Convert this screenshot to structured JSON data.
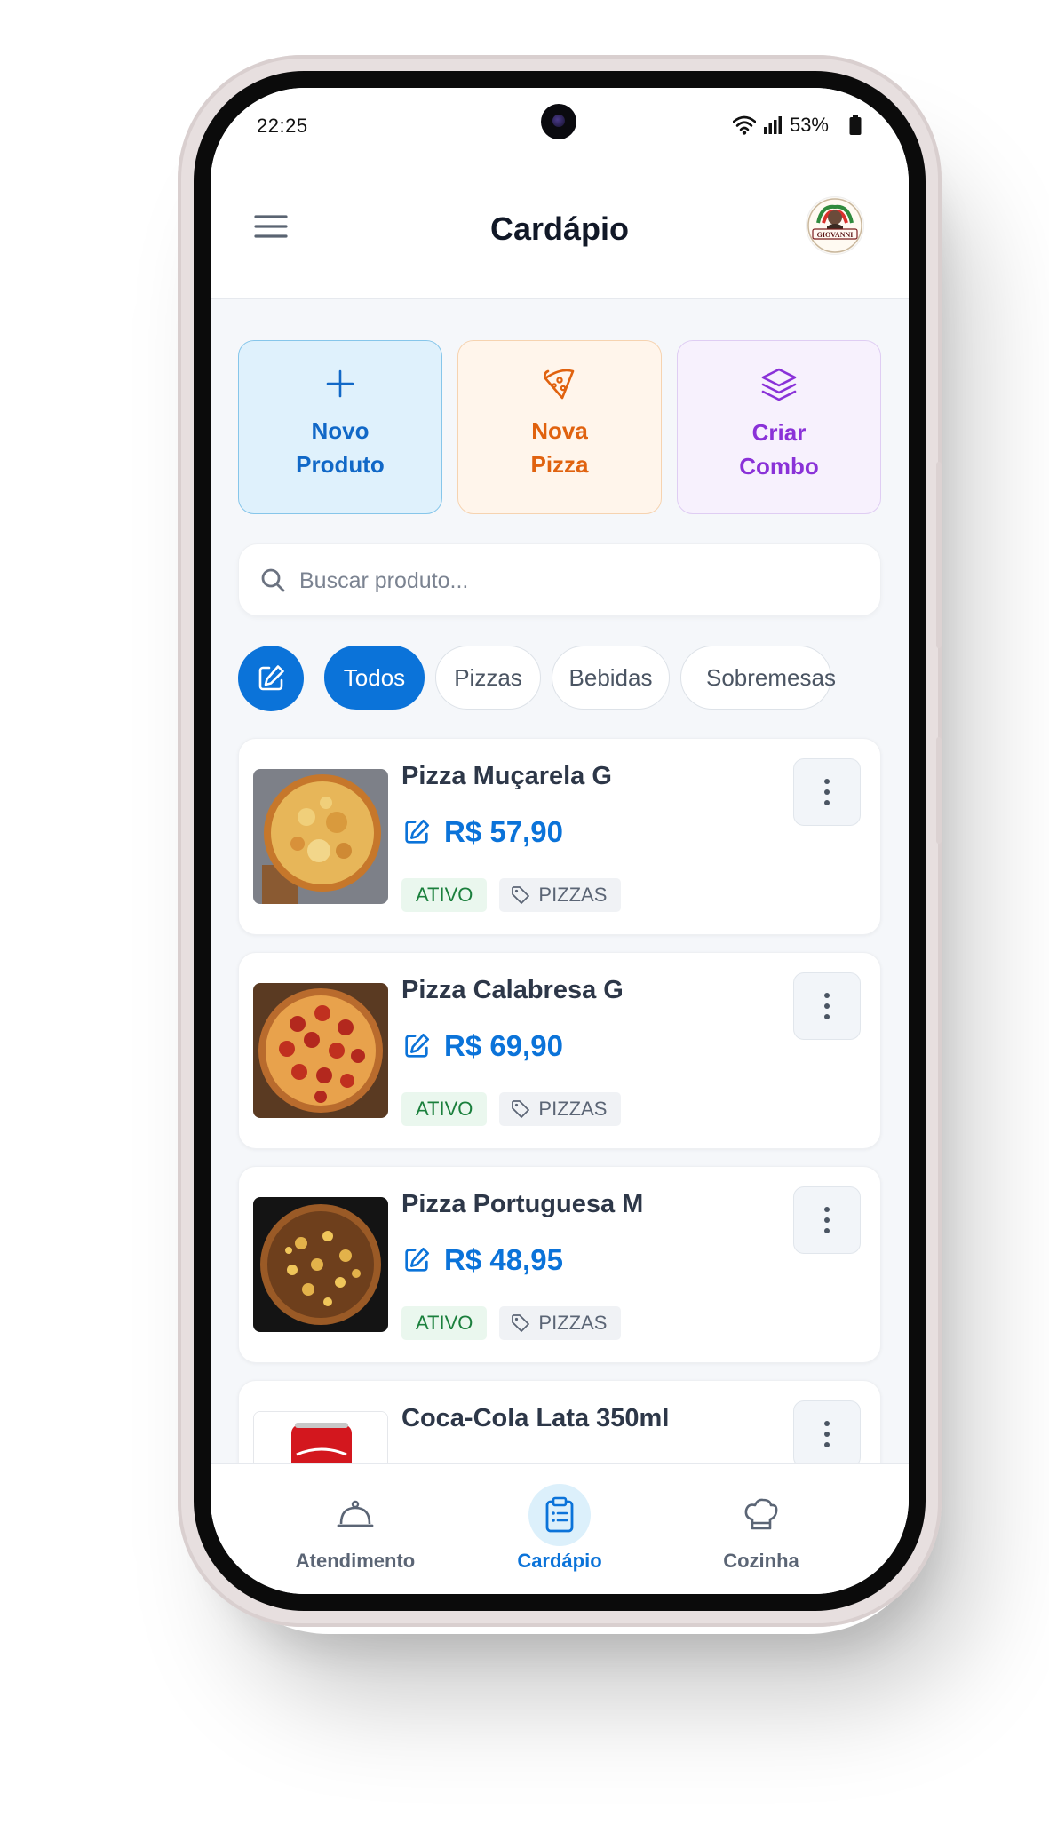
{
  "status_bar": {
    "time": "22:25",
    "battery": "53%"
  },
  "header": {
    "title": "Cardápio",
    "logo_text": "GIOVANNI"
  },
  "actions": [
    {
      "label": "Novo\nProduto",
      "icon": "plus-icon"
    },
    {
      "label": "Nova\nPizza",
      "icon": "pizza-slice-icon"
    },
    {
      "label": "Criar\nCombo",
      "icon": "layers-icon"
    }
  ],
  "search": {
    "placeholder": "Buscar produto..."
  },
  "filters": {
    "edit_icon": "edit-icon",
    "chips": [
      "Todos",
      "Pizzas",
      "Bebidas",
      "Sobremesas"
    ],
    "selected": "Todos"
  },
  "products": [
    {
      "name": "Pizza Muçarela G",
      "price": "R$ 57,90",
      "status": "ATIVO",
      "category": "PIZZAS"
    },
    {
      "name": "Pizza Calabresa G",
      "price": "R$ 69,90",
      "status": "ATIVO",
      "category": "PIZZAS"
    },
    {
      "name": "Pizza Portuguesa M",
      "price": "R$ 48,95",
      "status": "ATIVO",
      "category": "PIZZAS"
    },
    {
      "name": "Coca-Cola Lata 350ml"
    }
  ],
  "bottom_nav": [
    {
      "label": "Atendimento",
      "icon": "service-bell-icon"
    },
    {
      "label": "Cardápio",
      "icon": "clipboard-list-icon",
      "active": true
    },
    {
      "label": "Cozinha",
      "icon": "chef-hat-icon"
    }
  ],
  "colors": {
    "primary": "#0b73d9",
    "orange": "#e0620f",
    "purple": "#8a32d8",
    "success": "#1a7f3c"
  }
}
